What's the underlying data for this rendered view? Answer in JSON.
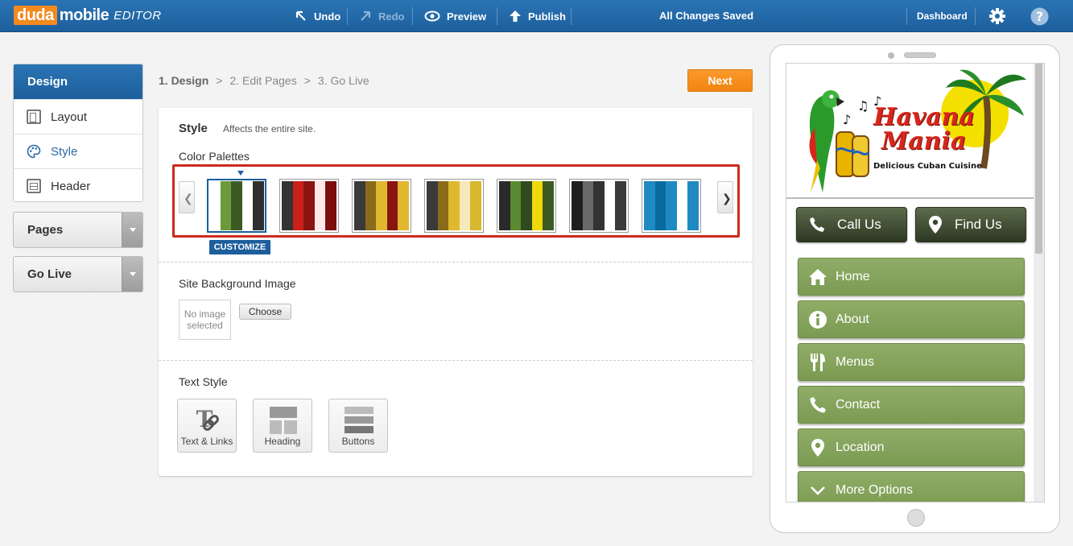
{
  "app": {
    "logo_duda": "duda",
    "logo_mobile": "mobile",
    "logo_editor": "EDITOR"
  },
  "toolbar": {
    "undo": "Undo",
    "redo": "Redo",
    "preview": "Preview",
    "publish": "Publish",
    "status": "All Changes Saved",
    "dashboard": "Dashboard"
  },
  "sidebar": {
    "title": "Design",
    "items": [
      {
        "label": "Layout"
      },
      {
        "label": "Style"
      },
      {
        "label": "Header"
      }
    ],
    "pages": "Pages",
    "golive": "Go Live"
  },
  "steps": {
    "s1": "1. Design",
    "sep1": ">",
    "s2": "2. Edit Pages",
    "sep2": ">",
    "s3": "3. Go Live"
  },
  "next_label": "Next",
  "style": {
    "title": "Style",
    "subtitle": "Affects the entire site.",
    "palettes_label": "Color Palettes",
    "customize": "CUSTOMIZE",
    "palettes": [
      [
        "#ffffff",
        "#6a9a3a",
        "#3d5a24",
        "#ffffff",
        "#2f2f2f"
      ],
      [
        "#333333",
        "#c8211a",
        "#8a1410",
        "#ffe8ea",
        "#7a0f0c"
      ],
      [
        "#3a3a3a",
        "#8a6b1a",
        "#e0b830",
        "#8a1410",
        "#e0b830"
      ],
      [
        "#3a3a3a",
        "#8a6b1a",
        "#e0b830",
        "#f6e8b8",
        "#d8b830"
      ],
      [
        "#2a2a2a",
        "#5a8a30",
        "#2f4a1c",
        "#f0d80a",
        "#3d5a24"
      ],
      [
        "#1e1e1e",
        "#6a6a6a",
        "#333333",
        "#ffffff",
        "#3a3a3a"
      ],
      [
        "#1f8ac2",
        "#0a6aa0",
        "#1f8ac2",
        "#ffffff",
        "#1f8ac2"
      ]
    ],
    "bg_label": "Site Background Image",
    "no_image": "No image selected",
    "choose": "Choose",
    "text_style_label": "Text Style",
    "text_btns": [
      {
        "label": "Text & Links"
      },
      {
        "label": "Heading"
      },
      {
        "label": "Buttons"
      }
    ]
  },
  "preview": {
    "brand_top": "Havana",
    "brand_bottom": "Mania",
    "tagline": "Delicious Cuban Cuisine",
    "call": "Call Us",
    "find": "Find Us",
    "nav": [
      {
        "label": "Home",
        "icon": "home-icon"
      },
      {
        "label": "About",
        "icon": "info-icon"
      },
      {
        "label": "Menus",
        "icon": "fork-knife-icon"
      },
      {
        "label": "Contact",
        "icon": "phone-icon"
      },
      {
        "label": "Location",
        "icon": "map-pin-icon"
      },
      {
        "label": "More Options",
        "icon": "chevron-down-icon"
      }
    ],
    "colors": {
      "nav_green": "#7e9d55",
      "cta_dark": "#3a4530",
      "brand_red": "#d8261b"
    }
  }
}
